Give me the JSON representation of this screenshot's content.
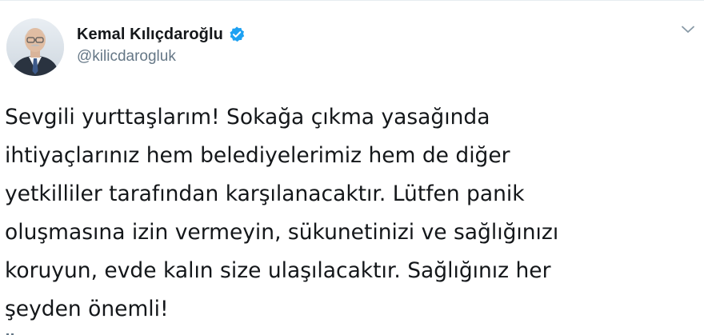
{
  "tweet": {
    "author": {
      "display_name": "Kemal Kılıçdaroğlu",
      "handle": "@kilicdarogluk",
      "verified": true,
      "avatar_icon": "profile-photo"
    },
    "menu_icon": "chevron-down-icon",
    "text_lines": [
      "Sevgili yurttaşlarım! Sokağa çıkma yasağında",
      "ihtiyaçlarınız hem belediyelerimiz hem de diğer",
      "yetkilliler tarafından karşılanacaktır. Lütfen panik",
      "oluşmasına izin vermeyin, sükunetinizi ve sağlığınızı",
      "koruyun, evde kalın size ulaşılacaktır. Sağlığınız her",
      "şeyden önemli!"
    ]
  },
  "colors": {
    "primary_text": "#14171a",
    "secondary_text": "#657786",
    "verified_badge": "#1da1f2",
    "divider": "#e6ecf0"
  }
}
